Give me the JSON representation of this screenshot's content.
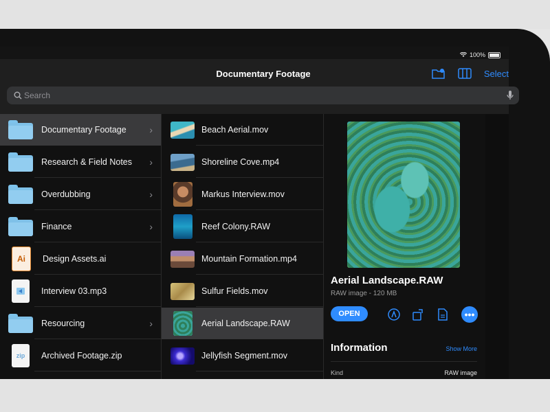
{
  "status": {
    "wifi": "wifi",
    "battery_text": "100%"
  },
  "navbar": {
    "title": "Documentary Footage",
    "select_label": "Select"
  },
  "search": {
    "placeholder": "Search"
  },
  "folders": [
    {
      "label": "Documentary Footage",
      "type": "folder",
      "selected": true
    },
    {
      "label": "Research & Field Notes",
      "type": "folder"
    },
    {
      "label": "Overdubbing",
      "type": "folder"
    },
    {
      "label": "Finance",
      "type": "folder"
    },
    {
      "label": "Design Assets.ai",
      "type": "ai-file",
      "icon_text": "Ai"
    },
    {
      "label": "Interview 03.mp3",
      "type": "audio-file"
    },
    {
      "label": "Resourcing",
      "type": "folder"
    },
    {
      "label": "Archived Footage.zip",
      "type": "zip-file",
      "icon_text": "zip"
    }
  ],
  "files": [
    {
      "label": "Beach Aerial.mov"
    },
    {
      "label": "Shoreline Cove.mp4"
    },
    {
      "label": "Markus Interview.mov"
    },
    {
      "label": "Reef Colony.RAW"
    },
    {
      "label": "Mountain Formation.mp4"
    },
    {
      "label": "Sulfur Fields.mov"
    },
    {
      "label": "Aerial Landscape.RAW",
      "selected": true
    },
    {
      "label": "Jellyfish Segment.mov"
    }
  ],
  "preview": {
    "title": "Aerial Landscape.RAW",
    "subtitle": "RAW image - 120 MB",
    "open_label": "OPEN",
    "more_label": "•••",
    "info_heading": "Information",
    "show_more": "Show More",
    "kind_label": "Kind",
    "kind_value": "RAW image"
  },
  "colors": {
    "accent": "#2f8cff",
    "background": "#111111",
    "folder": "#7fc1e8"
  }
}
